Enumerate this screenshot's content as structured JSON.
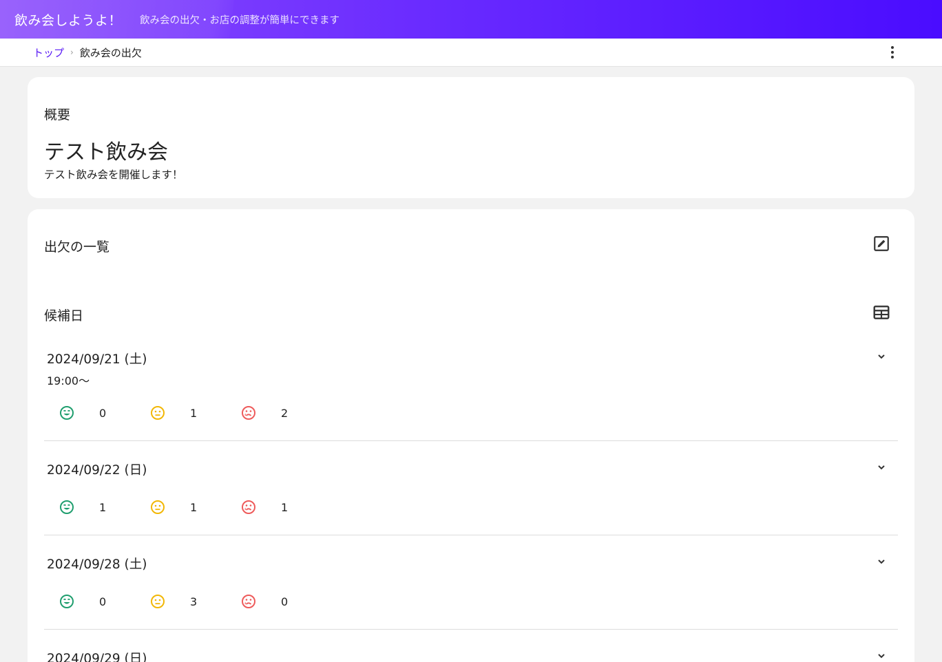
{
  "header": {
    "title": "飲み会しようよ！",
    "subtitle": "飲み会の出欠・お店の調整が簡単にできます"
  },
  "breadcrumb": {
    "home": "トップ",
    "current": "飲み会の出欠"
  },
  "summary": {
    "section_label": "概要",
    "event_title": "テスト飲み会",
    "event_description": "テスト飲み会を開催します！"
  },
  "attendance": {
    "section_label": "出欠の一覧",
    "candidates_label": "候補日",
    "dates": [
      {
        "date": "2024/09/21 (土)",
        "time": "19:00～",
        "yes": "0",
        "maybe": "1",
        "no": "2"
      },
      {
        "date": "2024/09/22 (日)",
        "time": "",
        "yes": "1",
        "maybe": "1",
        "no": "1"
      },
      {
        "date": "2024/09/28 (土)",
        "time": "",
        "yes": "0",
        "maybe": "3",
        "no": "0"
      },
      {
        "date": "2024/09/29 (日)",
        "time": "",
        "yes": "",
        "maybe": "",
        "no": ""
      }
    ]
  },
  "colors": {
    "yes": "#1f9e6e",
    "maybe": "#f2b705",
    "no": "#ee5a5a",
    "accent": "#5a1cf5"
  },
  "icons": {
    "edit": "edit-square-icon",
    "table": "table-view-icon",
    "expand": "chevron-down-icon",
    "menu": "more-vert-icon",
    "yes": "smile-face-icon",
    "maybe": "neutral-face-icon",
    "no": "sad-face-icon"
  }
}
